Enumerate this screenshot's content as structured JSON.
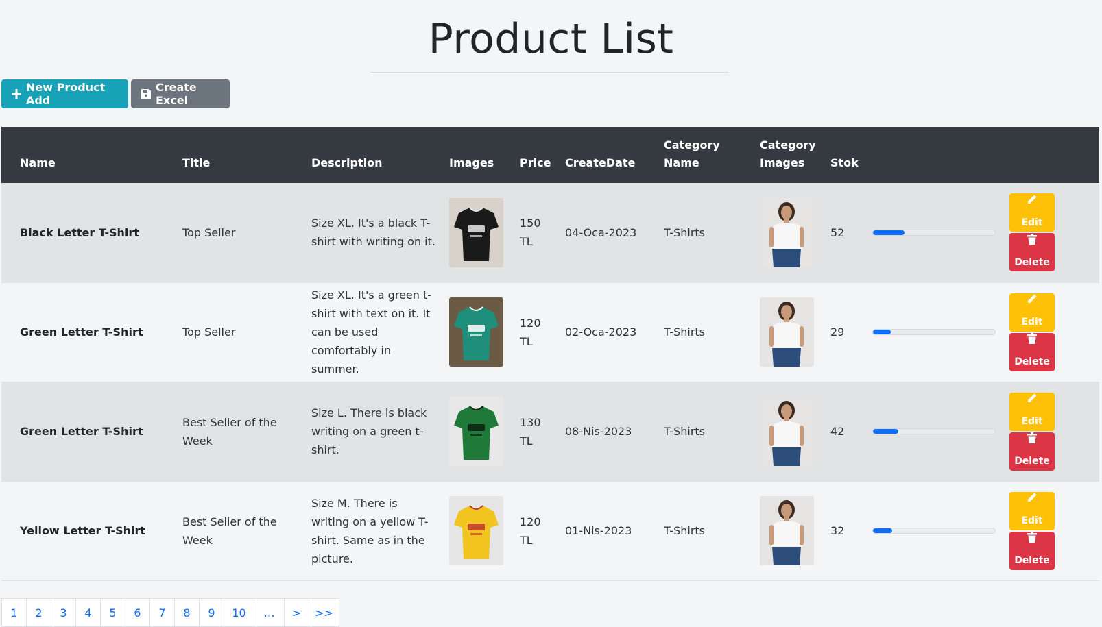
{
  "page": {
    "title": "Product List"
  },
  "toolbar": {
    "add_label": "New Product Add",
    "excel_label": "Create Excel"
  },
  "table": {
    "headers": [
      "Name",
      "Title",
      "Description",
      "Images",
      "Price",
      "CreateDate",
      "Category Name",
      "Category Images",
      "Stok"
    ],
    "rows": [
      {
        "name": "Black Letter T-Shirt",
        "title": "Top Seller",
        "description": "Size XL. It's a black T-shirt with writing on it.",
        "image_icon": "black-tshirt-photo",
        "price": "150 TL",
        "create_date": "04-Oca-2023",
        "category_name": "T-Shirts",
        "category_image_icon": "model-white-tshirt-photo",
        "stok": "52",
        "stock_level": 0.26,
        "edit_label": "Edit",
        "delete_label": "Delete"
      },
      {
        "name": "Green Letter T-Shirt",
        "title": "Top Seller",
        "description": "Size XL. It's a green t-shirt with text on it. It can be used comfortably in summer.",
        "image_icon": "teal-tshirt-photo",
        "price": "120 TL",
        "create_date": "02-Oca-2023",
        "category_name": "T-Shirts",
        "category_image_icon": "model-white-tshirt-photo",
        "stok": "29",
        "stock_level": 0.145,
        "edit_label": "Edit",
        "delete_label": "Delete"
      },
      {
        "name": "Green Letter T-Shirt",
        "title": "Best Seller of the Week",
        "description": "Size L. There is black writing on a green t-shirt.",
        "image_icon": "green-tshirt-photo",
        "price": "130 TL",
        "create_date": "08-Nis-2023",
        "category_name": "T-Shirts",
        "category_image_icon": "model-white-tshirt-photo",
        "stok": "42",
        "stock_level": 0.21,
        "edit_label": "Edit",
        "delete_label": "Delete"
      },
      {
        "name": "Yellow Letter T-Shirt",
        "title": "Best Seller of the Week",
        "description": "Size M. There is writing on a yellow T-shirt. Same as in the picture.",
        "image_icon": "yellow-tshirt-photo",
        "price": "120 TL",
        "create_date": "01-Nis-2023",
        "category_name": "T-Shirts",
        "category_image_icon": "model-white-tshirt-photo",
        "stok": "32",
        "stock_level": 0.16,
        "edit_label": "Edit",
        "delete_label": "Delete"
      }
    ]
  },
  "pagination": [
    "1",
    "2",
    "3",
    "4",
    "5",
    "6",
    "7",
    "8",
    "9",
    "10",
    "…",
    ">",
    ">>"
  ],
  "colors": {
    "add_button": "#17a2b8",
    "excel_button": "#6c757d",
    "header_bg": "#343a40",
    "edit_button": "#ffc107",
    "delete_button": "#dc3545",
    "progress": "#0d6efd",
    "link": "#0d6efd"
  }
}
